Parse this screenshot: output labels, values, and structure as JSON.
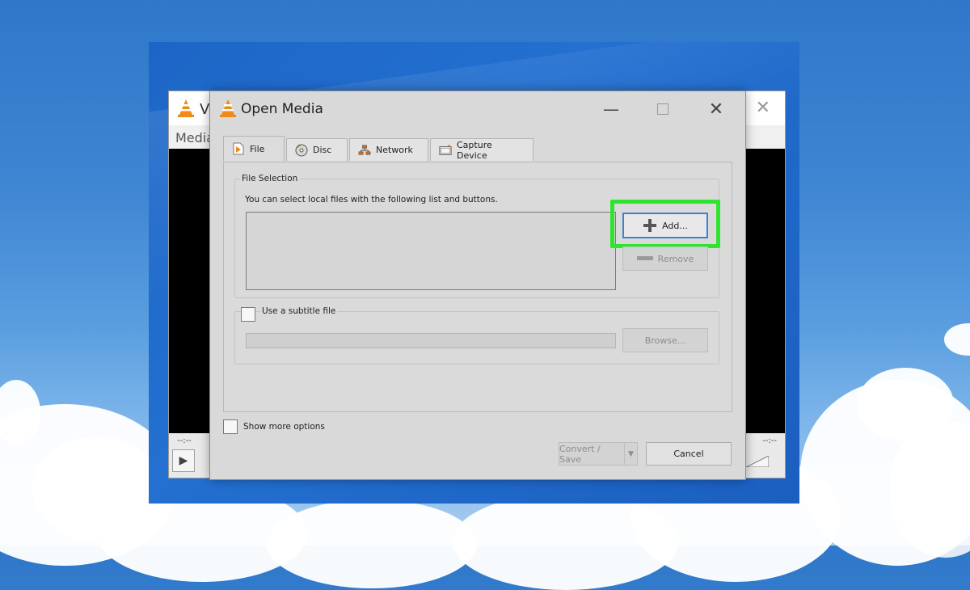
{
  "background_main": {
    "title": "VLC media player",
    "title_visible": "Vl",
    "menu_visible": "Media",
    "time_left": "--:--",
    "time_right": "--:--"
  },
  "dialog": {
    "title": "Open Media",
    "tabs": [
      {
        "label": "File",
        "icon": "play-file-icon"
      },
      {
        "label": "Disc",
        "icon": "disc-icon"
      },
      {
        "label": "Network",
        "icon": "network-icon"
      },
      {
        "label": "Capture Device",
        "icon": "capture-device-icon"
      }
    ],
    "file_selection": {
      "group_label": "File Selection",
      "hint": "You can select local files with the following list and buttons.",
      "add_label": "Add...",
      "remove_label": "Remove"
    },
    "subtitle": {
      "checkbox_label": "Use a subtitle file",
      "browse_label": "Browse..."
    },
    "show_more_label": "Show more options",
    "convert_save_label": "Convert / Save",
    "cancel_label": "Cancel"
  },
  "colors": {
    "highlight": "#2ee52e",
    "vlc_orange": "#f08a16",
    "focus_border": "#3c7fd4"
  }
}
